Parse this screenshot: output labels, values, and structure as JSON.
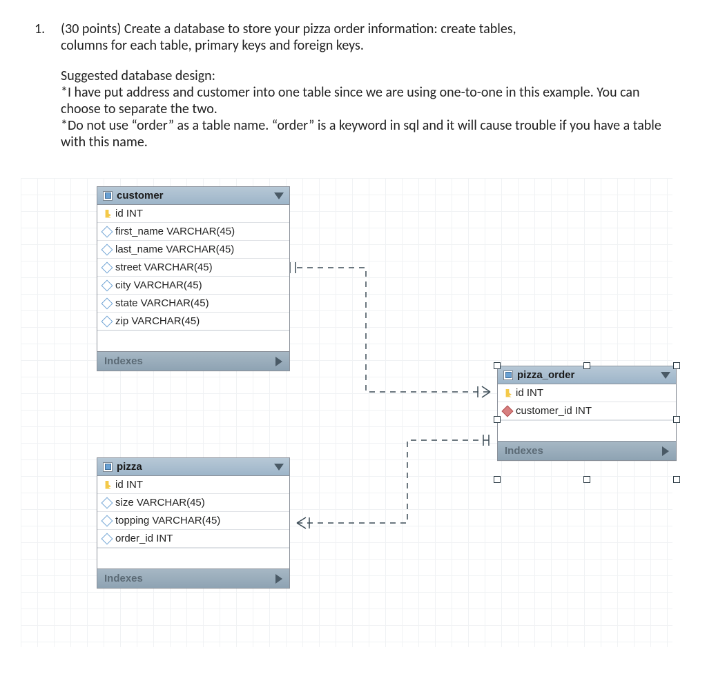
{
  "question": {
    "number": "1.",
    "prompt_line1": "(30 points) Create a database to store your pizza order information: create tables,",
    "prompt_line2": "columns for each table, primary keys and foreign keys.",
    "suggested_heading": "Suggested database design:",
    "note1": "*I have put address and customer into one table since we are using one-to-one in this example. You can choose to separate the two.",
    "note2": "*Do not use “order” as a table name. “order” is a keyword in sql and it will cause trouble if you have a table with this name."
  },
  "tables": {
    "customer": {
      "title": "customer",
      "columns": [
        {
          "icon": "key",
          "text": "id INT"
        },
        {
          "icon": "diamond",
          "text": "first_name VARCHAR(45)"
        },
        {
          "icon": "diamond",
          "text": "last_name VARCHAR(45)"
        },
        {
          "icon": "diamond",
          "text": "street VARCHAR(45)"
        },
        {
          "icon": "diamond",
          "text": "city VARCHAR(45)"
        },
        {
          "icon": "diamond",
          "text": "state VARCHAR(45)"
        },
        {
          "icon": "diamond",
          "text": "zip VARCHAR(45)"
        }
      ],
      "indexes_label": "Indexes"
    },
    "pizza": {
      "title": "pizza",
      "columns": [
        {
          "icon": "key",
          "text": "id INT"
        },
        {
          "icon": "diamond",
          "text": "size VARCHAR(45)"
        },
        {
          "icon": "diamond",
          "text": "topping VARCHAR(45)"
        },
        {
          "icon": "diamond",
          "text": "order_id INT"
        }
      ],
      "indexes_label": "Indexes"
    },
    "pizza_order": {
      "title": "pizza_order",
      "columns": [
        {
          "icon": "key",
          "text": "id INT"
        },
        {
          "icon": "fk",
          "text": "customer_id INT"
        }
      ],
      "indexes_label": "Indexes"
    }
  }
}
